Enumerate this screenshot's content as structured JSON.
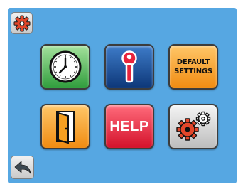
{
  "top_left": {
    "icon": "gear-icon"
  },
  "tiles": [
    {
      "icon": "clock-icon"
    },
    {
      "icon": "key-icon"
    },
    {
      "label_line1": "DEFAULT",
      "label_line2": "SETTINGS"
    },
    {
      "icon": "exit-door-icon"
    },
    {
      "label": "HELP"
    },
    {
      "icon": "gears-icon"
    }
  ],
  "back": {
    "icon": "back-arrow-icon"
  },
  "colors": {
    "screen_background": "#56a7e2",
    "clock_tile": "#4fb95a",
    "key_tile": "#1e4f9e",
    "default_tile": "#f6a021",
    "door_tile": "#f6a021",
    "help_tile": "#e8243c",
    "gears_tile": "#d6d6d6",
    "gear_accent": "#e3472a"
  }
}
